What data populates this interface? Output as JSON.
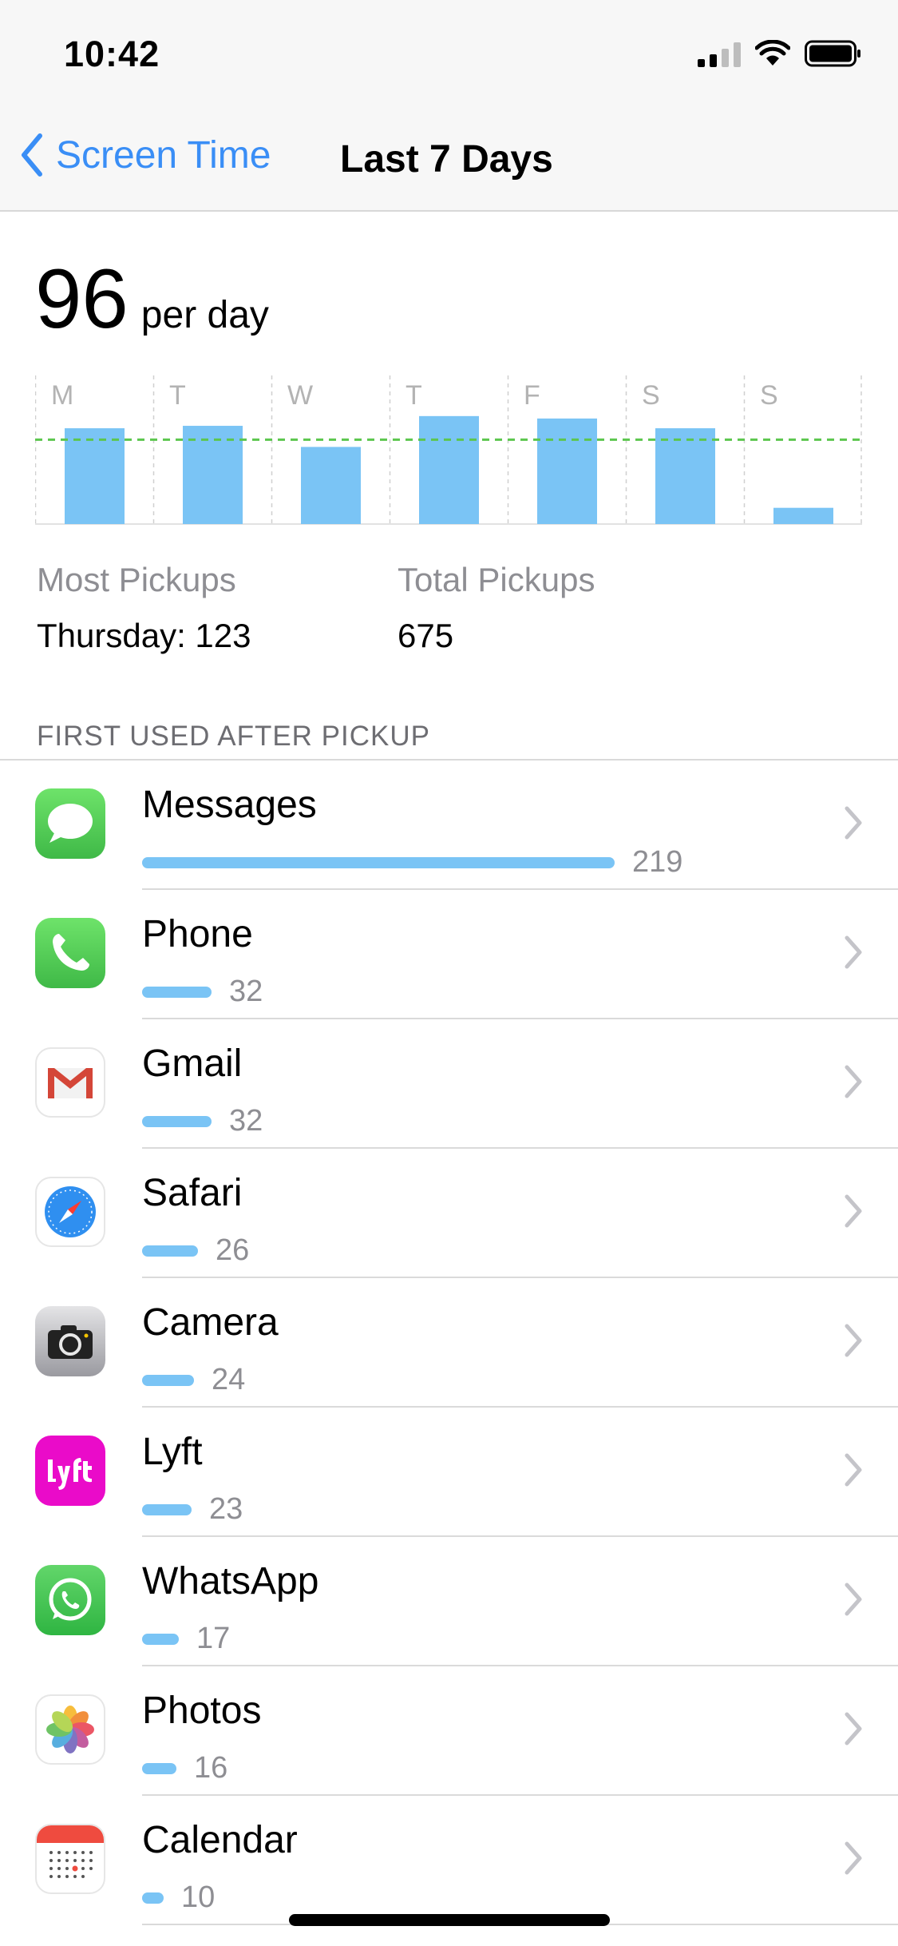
{
  "status": {
    "time": "10:42"
  },
  "nav": {
    "back_label": "Screen Time",
    "title": "Last 7 Days"
  },
  "summary": {
    "value": "96",
    "unit": "per day"
  },
  "chart_data": {
    "type": "bar",
    "categories": [
      "M",
      "T",
      "W",
      "T",
      "F",
      "S",
      "S"
    ],
    "values": [
      118,
      121,
      95,
      133,
      130,
      118,
      20
    ],
    "average": 104,
    "ylim": [
      0,
      185
    ],
    "xlabel": "",
    "ylabel": "",
    "title": "",
    "bar_color": "#7ac4f5",
    "average_line_color": "#5cc64e"
  },
  "stats": {
    "most_label": "Most Pickups",
    "most_value": "Thursday: 123",
    "total_label": "Total Pickups",
    "total_value": "675"
  },
  "section_header": "FIRST USED AFTER PICKUP",
  "apps": [
    {
      "name": "Messages",
      "count": "219",
      "value": 219,
      "icon": "messages-icon"
    },
    {
      "name": "Phone",
      "count": "32",
      "value": 32,
      "icon": "phone-icon"
    },
    {
      "name": "Gmail",
      "count": "32",
      "value": 32,
      "icon": "gmail-icon"
    },
    {
      "name": "Safari",
      "count": "26",
      "value": 26,
      "icon": "safari-icon"
    },
    {
      "name": "Camera",
      "count": "24",
      "value": 24,
      "icon": "camera-icon"
    },
    {
      "name": "Lyft",
      "count": "23",
      "value": 23,
      "icon": "lyft-icon"
    },
    {
      "name": "WhatsApp",
      "count": "17",
      "value": 17,
      "icon": "whatsapp-icon"
    },
    {
      "name": "Photos",
      "count": "16",
      "value": 16,
      "icon": "photos-icon"
    },
    {
      "name": "Calendar",
      "count": "10",
      "value": 10,
      "icon": "calendar-icon"
    }
  ],
  "colors": {
    "accent": "#3a8ef6",
    "usage_bar": "#7ac4f5"
  }
}
